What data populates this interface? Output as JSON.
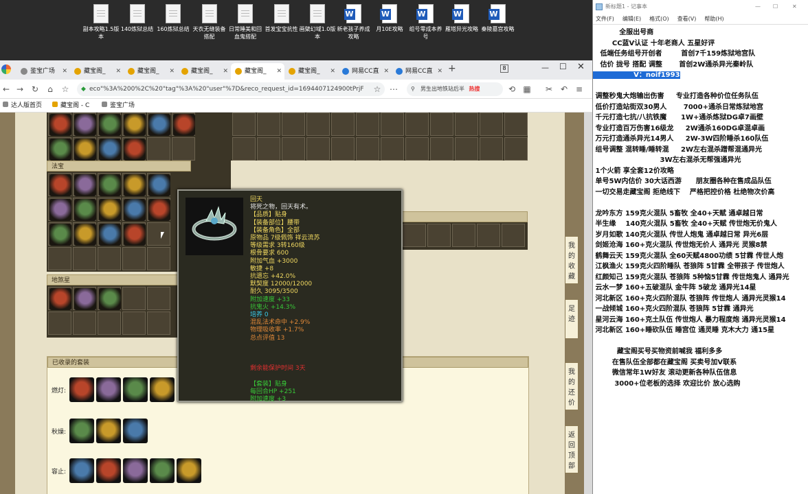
{
  "desktop": {
    "icons": [
      {
        "type": "doc",
        "label": "副本攻略1.5版本"
      },
      {
        "type": "doc",
        "label": "140炼狱总结"
      },
      {
        "type": "doc",
        "label": "160炼狱总结"
      },
      {
        "type": "doc",
        "label": "天衣无缝装备搭配"
      },
      {
        "type": "doc",
        "label": "日常睡美和回血鬼搭配"
      },
      {
        "type": "doc",
        "label": "首发宝宝抗性"
      },
      {
        "type": "doc",
        "label": "画檗幻域1.0版本"
      },
      {
        "type": "word",
        "label": "新老孩子养成攻略"
      },
      {
        "type": "word",
        "label": "月10E攻略"
      },
      {
        "type": "word",
        "label": "组号零成本养号"
      },
      {
        "type": "word",
        "label": "雁塔异光攻略"
      },
      {
        "type": "word",
        "label": "秦陵墓宫攻略"
      }
    ]
  },
  "browser": {
    "tabs": [
      {
        "label": "鉴宝广场",
        "icon": "globe-icon"
      },
      {
        "label": "藏宝阁_",
        "icon": "cbg-icon"
      },
      {
        "label": "藏宝阁_",
        "icon": "cbg-icon"
      },
      {
        "label": "藏宝阁_",
        "icon": "cbg-icon"
      },
      {
        "label": "藏宝阁_",
        "icon": "cbg-icon",
        "active": true
      },
      {
        "label": "藏宝阁_",
        "icon": "cbg-icon"
      },
      {
        "label": "网易CC直",
        "icon": "cc-icon"
      },
      {
        "label": "网易CC直",
        "icon": "cc-icon"
      }
    ],
    "tab_count_badge": "8",
    "new_tab": "+",
    "url": "eco\"%3A%200%2C%20\"tag\"%3A%20\"user\"%7D&reco_request_id=1694407124900tPrjF",
    "search_text": "男生出地铁站后半",
    "search_badge": "热搜",
    "bookmarks": [
      {
        "label": "达人版首页"
      },
      {
        "label": "藏宝阁 - C"
      },
      {
        "label": "鉴宝广场"
      }
    ]
  },
  "game_page": {
    "section_fabao": "法宝",
    "section_dizhaqi": "地煞星",
    "section_suits": "已收录的套装",
    "suit_rows": [
      {
        "label": "燃灯:",
        "count": 4
      },
      {
        "label": "秋燥:",
        "count": 3
      },
      {
        "label": "容止:",
        "count": 5
      }
    ],
    "side_buttons": [
      {
        "label": "我的收藏"
      },
      {
        "label": "足迹"
      },
      {
        "label": "我的还价"
      },
      {
        "label": "返回顶部"
      }
    ]
  },
  "tooltip": {
    "lines": [
      {
        "text": "回天",
        "color": "#f0d860"
      },
      {
        "text": "将死之物，回天有术。",
        "color": "#e8e8e8"
      },
      {
        "text": "【品质】贴身",
        "color": "#f0d860"
      },
      {
        "text": "【装备部位】腰带",
        "color": "#f0d860"
      },
      {
        "text": "【装备角色】全部",
        "color": "#f0d860"
      },
      {
        "text": "原物品 7级佩饰 祥云流苏",
        "color": "#f0d860"
      },
      {
        "text": "等级需求 3转160级",
        "color": "#f0d860"
      },
      {
        "text": "根骨要求 600",
        "color": "#f0d860"
      },
      {
        "text": "附加气血 +3000",
        "color": "#f0d860"
      },
      {
        "text": "敏捷 +8",
        "color": "#f0d860"
      },
      {
        "text": "抗遗忘 +42.0%",
        "color": "#f0d860"
      },
      {
        "text": "默契度 12000/12000",
        "color": "#f0d860"
      },
      {
        "text": "耐久 3095/3500",
        "color": "#f0d860"
      },
      {
        "text": "附加速度 +33",
        "color": "#38c838"
      },
      {
        "text": "抗鬼火 +14.3%",
        "color": "#38c838"
      },
      {
        "text": "培养 0",
        "color": "#38c8e8"
      },
      {
        "text": "混乱法术命中 +2.9%",
        "color": "#e08838"
      },
      {
        "text": "物理吸收率 +1.7%",
        "color": "#e08838"
      },
      {
        "text": "总点评值  13",
        "color": "#e08838"
      },
      {
        "text": "",
        "color": "#000"
      },
      {
        "text": "",
        "color": "#000"
      },
      {
        "text": "",
        "color": "#000"
      },
      {
        "text": "剩余能保护时间     3天",
        "color": "#e03030"
      },
      {
        "text": "",
        "color": "#000"
      },
      {
        "text": "【套装】贴身",
        "color": "#38c838"
      },
      {
        "text": "每回合HP +251",
        "color": "#38c838"
      },
      {
        "text": "附加速度 +3",
        "color": "#38c838"
      }
    ]
  },
  "notepad": {
    "title": "新标题1 - 记事本",
    "menu": [
      "文件(F)",
      "编辑(E)",
      "格式(O)",
      "查看(V)",
      "帮助(H)"
    ],
    "lines": [
      {
        "text": "           全服出号商"
      },
      {
        "text": "        CC蓝V认证 十年老商人 五星好评"
      },
      {
        "text": "   低端任务组号开创者        首创7千159炼狱地宫队"
      },
      {
        "text": "   估价 拢号 搭配 调整       首创2W通杀异光秦岭队"
      },
      {
        "text": "                 V：noif1993",
        "hl": true
      },
      {
        "text": ""
      },
      {
        "text": " 调整秒鬼大炮输出伤害     专业打造各种价位任务队伍"
      },
      {
        "text": " 低价打造站街双30男人       7000+通杀日常炼狱地宫"
      },
      {
        "text": " 千元打造七抗/八抗铁魔      1W+通杀炼狱DG卓7画壁"
      },
      {
        "text": " 专业打造百万伤害16级龙     2W通杀160DG卓混卓画"
      },
      {
        "text": " 万元打造通杀异光14男人     2W-3W四阶睡杀160队伍"
      },
      {
        "text": " 组号调整 混转睡/睡转混     2W左右混杀蹭帮混通异光"
      },
      {
        "text": "                            3W左右混杀无帮强通异光"
      },
      {
        "text": " 1个火箭 享全套12价攻略"
      },
      {
        "text": " 单号5W内估价 30大话西游      朋友圈各种在售成品队伍"
      },
      {
        "text": " 一切交易走藏宝阁 拒绝线下    严格把控价格 杜绝物次价高"
      },
      {
        "text": ""
      },
      {
        "text": " 龙吟东方 159克火混队 5畜牧 全40+天赋 通卓越日常"
      },
      {
        "text": " 半生缘    140克火混队 5畜牧 全40+天赋 传世炮无价鬼人"
      },
      {
        "text": " 岁月如歌 140克火混队 传世人炮鬼 通卓越日常 异光6层"
      },
      {
        "text": " 剑姬沧海 160+克火混队 传世炮无价人 通异光 灵猴8禁"
      },
      {
        "text": " 鹤舞云天 159克火混队 全60天赋4800功绩 5甘霖 传世人炮"
      },
      {
        "text": " 江枫渔火 159克火四阶睡队 苍狼阵 5甘霖 全带孩子 传世炮人"
      },
      {
        "text": " 红颜知己 159克火混队 苍狼阵 5种恼5甘霖 传世炮鬼人 通异光"
      },
      {
        "text": " 云水一梦 160+五破混队 金牛阵 5破龙 通异光14星"
      },
      {
        "text": " 河北新区 160+克火四阶混队 苍狼阵 传世炮人 通异光灵猴14"
      },
      {
        "text": " 一战倾城 160+克火四阶混队 苍狼阵 5甘霖 通异光"
      },
      {
        "text": " 星河云海 160+克土队伍 传世炮人 暴力程度炮 通异光灵猴14"
      },
      {
        "text": " 河北新区 160+睡砍队伍 睡宫位 通灵睡 克木大力 通15星"
      },
      {
        "text": ""
      },
      {
        "text": "          藏宝阁买号买物资前喊我 福利多多"
      },
      {
        "text": "        在售队伍全部都在藏宝阁 买卖号加V联系"
      },
      {
        "text": "        微信常年1W好友 滚动更新各种队伍信息"
      },
      {
        "text": "         3000+位老板的选择 欢迎比价 放心选购"
      }
    ]
  },
  "colors": {
    "item_a": "#b8452a",
    "item_b": "#8a6a9a",
    "item_c": "#5a8a4a",
    "item_d": "#c89a2a",
    "item_e": "#4a7aaa"
  }
}
